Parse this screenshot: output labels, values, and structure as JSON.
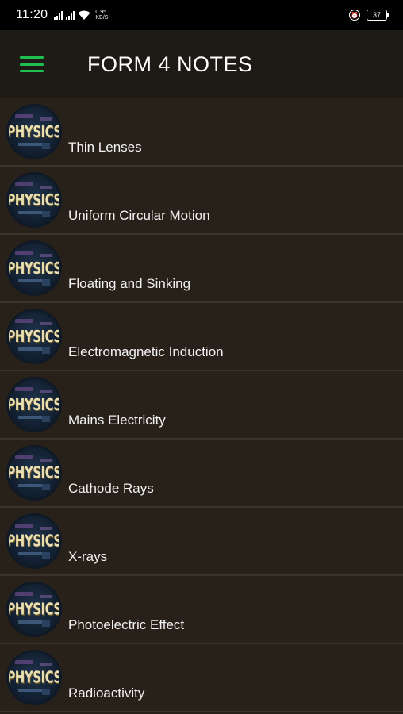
{
  "status_bar": {
    "time": "11:20",
    "speed_value": "0.95",
    "speed_unit": "KB/S",
    "battery": "37",
    "icons": [
      "signal-icon",
      "signal-icon",
      "wifi-icon",
      "alarm-icon",
      "battery-icon"
    ]
  },
  "app_bar": {
    "title": "FORM 4 NOTES",
    "menu_icon": "hamburger-menu-icon",
    "accent_color": "#1ebf4e"
  },
  "thumbnail_text": "PHYSICS",
  "items": [
    {
      "label": "Thin Lenses"
    },
    {
      "label": "Uniform Circular Motion"
    },
    {
      "label": "Floating and Sinking"
    },
    {
      "label": "Electromagnetic Induction"
    },
    {
      "label": "Mains Electricity"
    },
    {
      "label": "Cathode Rays"
    },
    {
      "label": "X-rays"
    },
    {
      "label": "Photoelectric Effect"
    },
    {
      "label": "Radioactivity"
    }
  ],
  "colors": {
    "background": "#282119",
    "app_bar": "#1e1b16",
    "divider": "#3a332b"
  }
}
